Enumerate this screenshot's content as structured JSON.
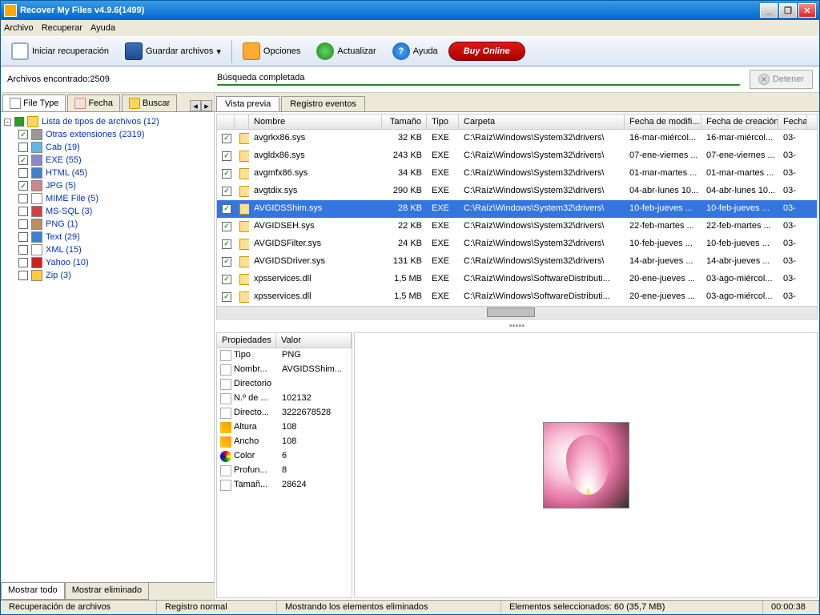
{
  "window": {
    "title": "Recover My Files v4.9.6(1499)"
  },
  "menu": {
    "archivo": "Archivo",
    "recuperar": "Recuperar",
    "ayuda": "Ayuda"
  },
  "toolbar": {
    "iniciar": "Iniciar recuperación",
    "guardar": "Guardar archivos",
    "opciones": "Opciones",
    "actualizar": "Actualizar",
    "ayuda": "Ayuda",
    "buy": "Buy Online"
  },
  "status": {
    "found_label": "Archivos encontrado:2509",
    "search": "Búsqueda completada",
    "stop": "Detener"
  },
  "lefttabs": {
    "filetype": "File Type",
    "fecha": "Fecha",
    "buscar": "Buscar"
  },
  "tree": {
    "root": "Lista de tipos de archivos (12)",
    "items": [
      {
        "label": "Otras extensiones (2319)",
        "chk": true,
        "color": "#999"
      },
      {
        "label": "Cab (19)",
        "chk": false,
        "color": "#5cb8e6"
      },
      {
        "label": "EXE (55)",
        "chk": true,
        "color": "#88c"
      },
      {
        "label": "HTML (45)",
        "chk": false,
        "color": "#4080d0"
      },
      {
        "label": "JPG (5)",
        "chk": true,
        "color": "#c88"
      },
      {
        "label": "MIME File (5)",
        "chk": false,
        "color": "#fff"
      },
      {
        "label": "MS-SQL (3)",
        "chk": false,
        "color": "#d04040"
      },
      {
        "label": "PNG (1)",
        "chk": false,
        "color": "#b89060"
      },
      {
        "label": "Text (29)",
        "chk": false,
        "color": "#4080d0"
      },
      {
        "label": "XML (15)",
        "chk": false,
        "color": "#fff"
      },
      {
        "label": "Yahoo (10)",
        "chk": false,
        "color": "#d02020"
      },
      {
        "label": "Zip (3)",
        "chk": false,
        "color": "#ffcc33"
      }
    ]
  },
  "bottomtabs": {
    "all": "Mostrar todo",
    "del": "Mostrar eliminado"
  },
  "righttabs": {
    "preview": "Vista previa",
    "log": "Registro eventos"
  },
  "cols": {
    "nombre": "Nombre",
    "tam": "Tamaño",
    "tipo": "Tipo",
    "carpeta": "Carpeta",
    "fmod": "Fecha de modifi...",
    "fcre": "Fecha de creación",
    "fa": "Fecha t"
  },
  "files": [
    {
      "n": "avgrkx86.sys",
      "s": "32 KB",
      "t": "EXE",
      "c": "C:\\Raíz\\Windows\\System32\\drivers\\",
      "m": "16-mar-miércol...",
      "cr": "16-mar-miércol...",
      "a": "03-"
    },
    {
      "n": "avgldx86.sys",
      "s": "243 KB",
      "t": "EXE",
      "c": "C:\\Raíz\\Windows\\System32\\drivers\\",
      "m": "07-ene-viernes ...",
      "cr": "07-ene-viernes ...",
      "a": "03-"
    },
    {
      "n": "avgmfx86.sys",
      "s": "34 KB",
      "t": "EXE",
      "c": "C:\\Raíz\\Windows\\System32\\drivers\\",
      "m": "01-mar-martes ...",
      "cr": "01-mar-martes ...",
      "a": "03-"
    },
    {
      "n": "avgtdix.sys",
      "s": "290 KB",
      "t": "EXE",
      "c": "C:\\Raíz\\Windows\\System32\\drivers\\",
      "m": "04-abr-lunes 10...",
      "cr": "04-abr-lunes 10...",
      "a": "03-"
    },
    {
      "n": "AVGIDSShim.sys",
      "s": "28 KB",
      "t": "EXE",
      "c": "C:\\Raíz\\Windows\\System32\\drivers\\",
      "m": "10-feb-jueves ...",
      "cr": "10-feb-jueves ...",
      "a": "03-",
      "sel": true
    },
    {
      "n": "AVGIDSEH.sys",
      "s": "22 KB",
      "t": "EXE",
      "c": "C:\\Raíz\\Windows\\System32\\drivers\\",
      "m": "22-feb-martes ...",
      "cr": "22-feb-martes ...",
      "a": "03-"
    },
    {
      "n": "AVGIDSFilter.sys",
      "s": "24 KB",
      "t": "EXE",
      "c": "C:\\Raíz\\Windows\\System32\\drivers\\",
      "m": "10-feb-jueves ...",
      "cr": "10-feb-jueves ...",
      "a": "03-"
    },
    {
      "n": "AVGIDSDriver.sys",
      "s": "131 KB",
      "t": "EXE",
      "c": "C:\\Raíz\\Windows\\System32\\drivers\\",
      "m": "14-abr-jueves ...",
      "cr": "14-abr-jueves ...",
      "a": "03-"
    },
    {
      "n": "xpsservices.dll",
      "s": "1,5 MB",
      "t": "EXE",
      "c": "C:\\Raíz\\Windows\\SoftwareDistributi...",
      "m": "20-ene-jueves ...",
      "cr": "03-ago-miércol...",
      "a": "03-"
    },
    {
      "n": "xpsservices.dll",
      "s": "1,5 MB",
      "t": "EXE",
      "c": "C:\\Raíz\\Windows\\SoftwareDistributi...",
      "m": "20-ene-jueves ...",
      "cr": "03-ago-miércol...",
      "a": "03-"
    }
  ],
  "propcols": {
    "k": "Propiedades",
    "v": "Valor"
  },
  "props": [
    {
      "ic": "page",
      "k": "Tipo",
      "v": "PNG"
    },
    {
      "ic": "page",
      "k": "Nombr...",
      "v": "AVGIDSShim..."
    },
    {
      "ic": "page",
      "k": "Directorio",
      "v": ""
    },
    {
      "ic": "page",
      "k": "N.º de ...",
      "v": "102132"
    },
    {
      "ic": "page",
      "k": "Directo...",
      "v": "3222678528"
    },
    {
      "ic": "ruler",
      "k": "Altura",
      "v": "108"
    },
    {
      "ic": "ruler",
      "k": "Ancho",
      "v": "108"
    },
    {
      "ic": "pal",
      "k": "Color",
      "v": "6"
    },
    {
      "ic": "page",
      "k": "Profun...",
      "v": "8"
    },
    {
      "ic": "page",
      "k": "Tamañ...",
      "v": "28624"
    }
  ],
  "statusbar": {
    "s1": "Recuperación de archivos",
    "s2": "Registro normal",
    "s3": "Mostrando los elementos eliminados",
    "s4": "Elementos seleccionados: 60 (35,7 MB)",
    "s5": "00:00:38"
  }
}
